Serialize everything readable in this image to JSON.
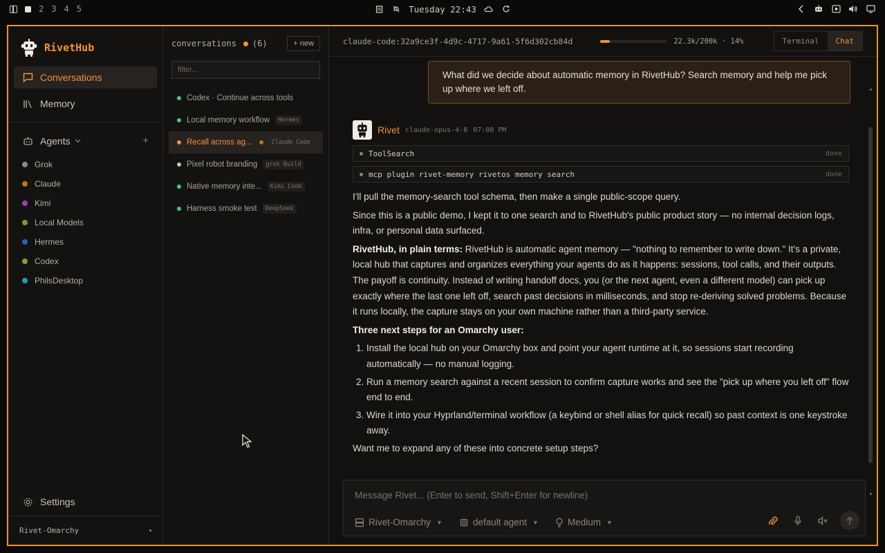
{
  "system_bar": {
    "workspaces": [
      "2",
      "3",
      "4",
      "5"
    ],
    "clock": "Tuesday 22:43"
  },
  "app": {
    "name": "RivetHub",
    "nav": [
      {
        "label": "Conversations",
        "icon": "chat-bubble-icon",
        "active": true
      },
      {
        "label": "Memory",
        "icon": "library-icon",
        "active": false
      }
    ],
    "agents_label": "Agents",
    "agents": [
      {
        "name": "Grok",
        "color": "#8a8a8a"
      },
      {
        "name": "Claude",
        "color": "#b8741f"
      },
      {
        "name": "Kimi",
        "color": "#9b3fb8"
      },
      {
        "name": "Local Models",
        "color": "#7a9a2a"
      },
      {
        "name": "Hermes",
        "color": "#2f5fb8"
      },
      {
        "name": "Codex",
        "color": "#8aa02a"
      },
      {
        "name": "PhilsDesktop",
        "color": "#2a9ab0"
      }
    ],
    "settings_label": "Settings",
    "workspace_name": "Rivet-Omarchy"
  },
  "conversations": {
    "header": "conversations",
    "count": "(6)",
    "new_label": "+ new",
    "filter_placeholder": "filter...",
    "items": [
      {
        "title": "Codex · Continue across tools",
        "tag": "",
        "active": false
      },
      {
        "title": "Local memory workflow",
        "tag": "Hermes",
        "active": false
      },
      {
        "title": "Recall across ag...",
        "tag": "Claude Code",
        "active": true
      },
      {
        "title": "Pixel robot branding",
        "tag": "grok Build",
        "active": false
      },
      {
        "title": "Native memory inte...",
        "tag": "Kimi Code",
        "active": false
      },
      {
        "title": "Harness smoke test",
        "tag": "DeepSeek",
        "active": false
      }
    ]
  },
  "session": {
    "id": "claude-code:32a9ce3f-4d9c-4717-9a61-5f6d302cb84d",
    "usage_fraction": 0.14,
    "tokens": "22.3k/200k · 14%",
    "modes": [
      "Terminal",
      "Chat"
    ],
    "active_mode": "Chat"
  },
  "chat": {
    "user_message": "What did we decide about automatic memory in RivetHub? Search memory and help me pick up where we left off.",
    "assistant_name": "Rivet",
    "assistant_model": "claude-opus-4-8",
    "assistant_time": "07:00 PM",
    "tools": [
      {
        "name": "ToolSearch",
        "status": "done"
      },
      {
        "name": "mcp plugin rivet-memory rivetos memory search",
        "status": "done"
      }
    ],
    "p1": "I'll pull the memory-search tool schema, then make a single public-scope query.",
    "p2": "Since this is a public demo, I kept it to one search and to RivetHub's public product story — no internal decision logs, infra, or personal data surfaced.",
    "p3_bold": "RivetHub, in plain terms:",
    "p3": " RivetHub is automatic agent memory — \"nothing to remember to write down.\" It's a private, local hub that captures and organizes everything your agents do as it happens: sessions, tool calls, and their outputs. The payoff is continuity. Instead of writing handoff docs, you (or the next agent, even a different model) can pick up exactly where the last one left off, search past decisions in milliseconds, and stop re-deriving solved problems. Because it runs locally, the capture stays on your own machine rather than a third-party service.",
    "steps_heading": "Three next steps for an Omarchy user:",
    "steps": [
      "Install the local hub on your Omarchy box and point your agent runtime at it, so sessions start recording automatically — no manual logging.",
      "Run a memory search against a recent session to confirm capture works and see the \"pick up where you left off\" flow end to end.",
      "Wire it into your Hyprland/terminal workflow (a keybind or shell alias for quick recall) so past context is one keystroke away."
    ],
    "closing": "Want me to expand any of these into concrete setup steps?"
  },
  "composer": {
    "placeholder": "Message Rivet... (Enter to send, Shift+Enter for newline)",
    "workspace": "Rivet-Omarchy",
    "agent": "default agent",
    "effort": "Medium"
  },
  "colors": {
    "accent": "#f0913e",
    "online": "#3ec98a"
  }
}
